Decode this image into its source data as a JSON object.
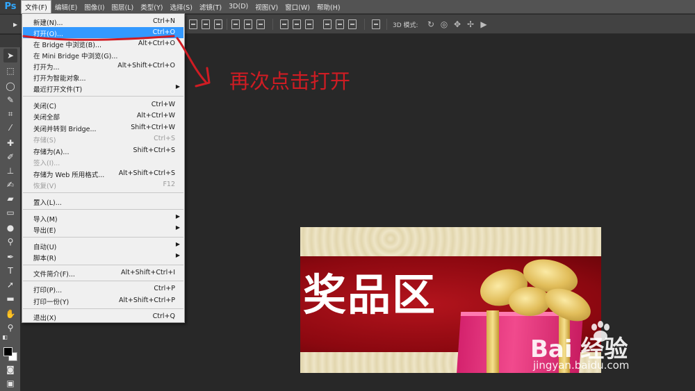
{
  "app": {
    "logo": "Ps"
  },
  "menubar": {
    "items": [
      "文件(F)",
      "编辑(E)",
      "图像(I)",
      "图层(L)",
      "类型(Y)",
      "选择(S)",
      "滤镜(T)",
      "3D(D)",
      "视图(V)",
      "窗口(W)",
      "帮助(H)"
    ],
    "active": "文件(F)"
  },
  "optionsbar": {
    "mode_3d_label": "3D 模式:"
  },
  "file_menu": {
    "items": [
      {
        "label": "新建(N)...",
        "shortcut": "Ctrl+N"
      },
      {
        "label": "打开(O)...",
        "shortcut": "Ctrl+O",
        "highlighted": true
      },
      {
        "label": "在 Bridge 中浏览(B)...",
        "shortcut": "Alt+Ctrl+O"
      },
      {
        "label": "在 Mini Bridge 中浏览(G)...",
        "shortcut": ""
      },
      {
        "label": "打开为...",
        "shortcut": "Alt+Shift+Ctrl+O"
      },
      {
        "label": "打开为智能对象...",
        "shortcut": ""
      },
      {
        "label": "最近打开文件(T)",
        "shortcut": "",
        "submenu": true
      },
      {
        "label": "关闭(C)",
        "shortcut": "Ctrl+W"
      },
      {
        "label": "关闭全部",
        "shortcut": "Alt+Ctrl+W"
      },
      {
        "label": "关闭并转到 Bridge...",
        "shortcut": "Shift+Ctrl+W"
      },
      {
        "label": "存储(S)",
        "shortcut": "Ctrl+S",
        "disabled": true
      },
      {
        "label": "存储为(A)...",
        "shortcut": "Shift+Ctrl+S"
      },
      {
        "label": "签入(I)...",
        "shortcut": "",
        "disabled": true
      },
      {
        "label": "存储为 Web 所用格式...",
        "shortcut": "Alt+Shift+Ctrl+S"
      },
      {
        "label": "恢复(V)",
        "shortcut": "F12",
        "disabled": true
      },
      {
        "label": "置入(L)...",
        "shortcut": ""
      },
      {
        "label": "导入(M)",
        "shortcut": "",
        "submenu": true
      },
      {
        "label": "导出(E)",
        "shortcut": "",
        "submenu": true
      },
      {
        "label": "自动(U)",
        "shortcut": "",
        "submenu": true
      },
      {
        "label": "脚本(R)",
        "shortcut": "",
        "submenu": true
      },
      {
        "label": "文件简介(F)...",
        "shortcut": "Alt+Shift+Ctrl+I"
      },
      {
        "label": "打印(P)...",
        "shortcut": "Ctrl+P"
      },
      {
        "label": "打印一份(Y)",
        "shortcut": "Alt+Shift+Ctrl+P"
      },
      {
        "label": "退出(X)",
        "shortcut": "Ctrl+Q"
      }
    ]
  },
  "annotation": {
    "text": "再次点击打开",
    "color": "#cf1c23"
  },
  "canvas": {
    "image_text": "奖品区"
  },
  "watermark": {
    "brand": "Bai  经验",
    "url": "jingyan.baidu.com"
  },
  "colors": {
    "highlight": "#3399ff",
    "annotation": "#cf1c23",
    "ps_blue": "#31a8ff"
  }
}
